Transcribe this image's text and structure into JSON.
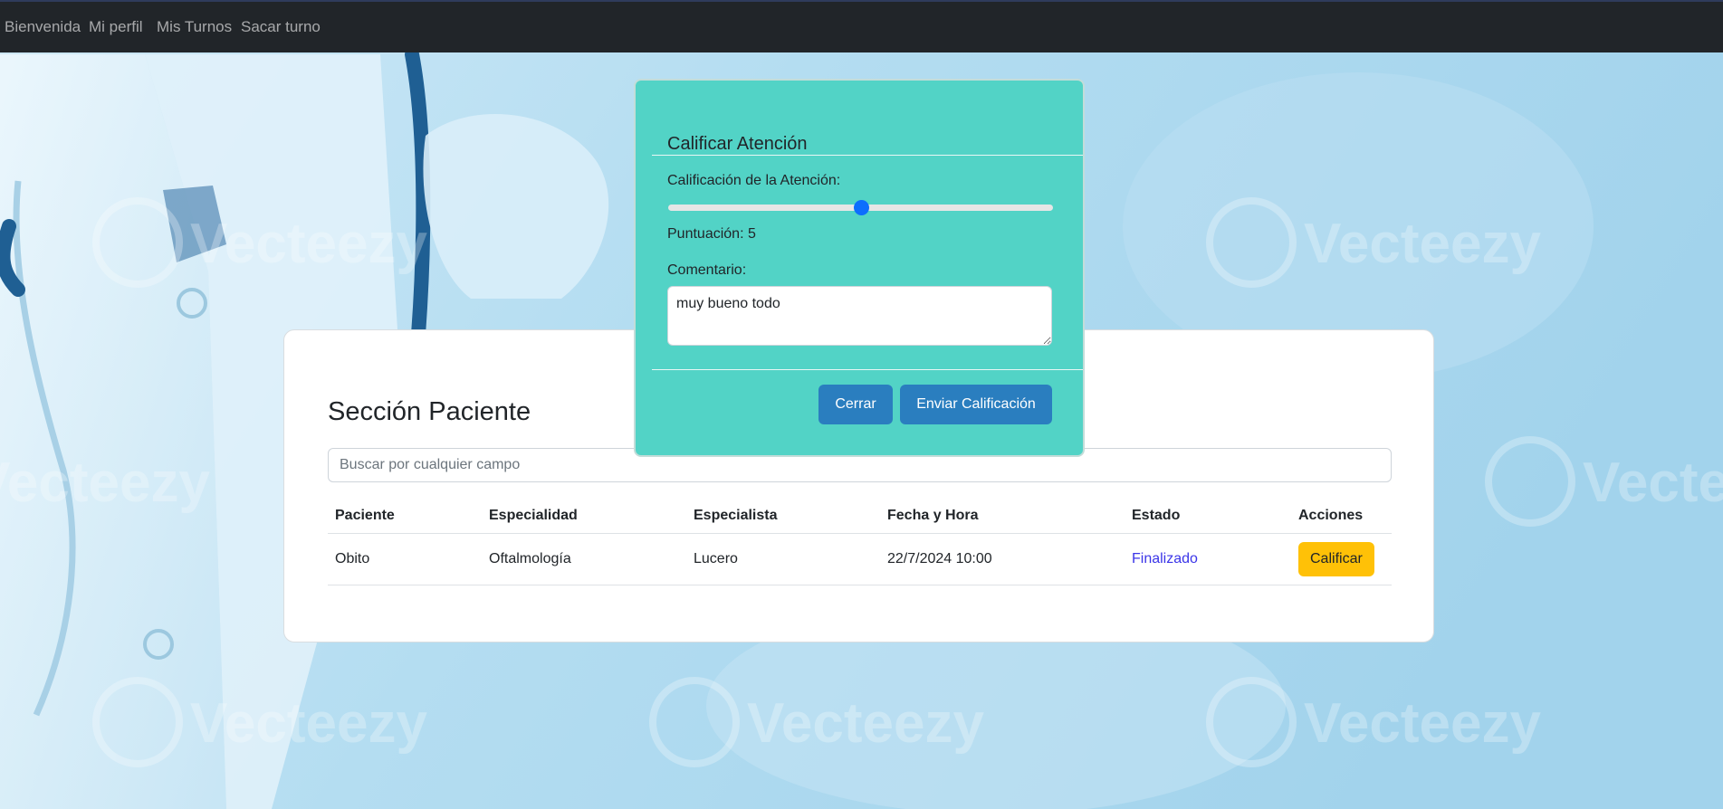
{
  "nav": {
    "items": [
      "Bienvenida",
      "Mi perfil",
      "Mis Turnos",
      "Sacar turno"
    ]
  },
  "background": {
    "watermark_text": "Vecteezy"
  },
  "section": {
    "title": "Sección Paciente",
    "search_placeholder": "Buscar por cualquier campo",
    "search_value": ""
  },
  "table": {
    "headers": [
      "Paciente",
      "Especialidad",
      "Especialista",
      "Fecha y Hora",
      "Estado",
      "Acciones"
    ],
    "rows": [
      {
        "paciente": "Obito",
        "especialidad": "Oftalmología",
        "especialista": "Lucero",
        "fecha_hora": "22/7/2024 10:00",
        "estado": "Finalizado",
        "accion": "Calificar"
      }
    ]
  },
  "modal": {
    "title": "Calificar Atención",
    "rating_label": "Calificación de la Atención:",
    "rating_value": 5,
    "rating_min": 0,
    "rating_max": 10,
    "score_text": "Puntuación: 5",
    "comment_label": "Comentario:",
    "comment_value": "muy bueno todo",
    "close_label": "Cerrar",
    "submit_label": "Enviar Calificación"
  },
  "colors": {
    "navbar": "#212529",
    "modal_bg": "#52d3c6",
    "primary_button": "#2a7ebf",
    "warning_button": "#ffc107",
    "status_link": "#3b35e8",
    "slider_thumb": "#0d6efd"
  }
}
